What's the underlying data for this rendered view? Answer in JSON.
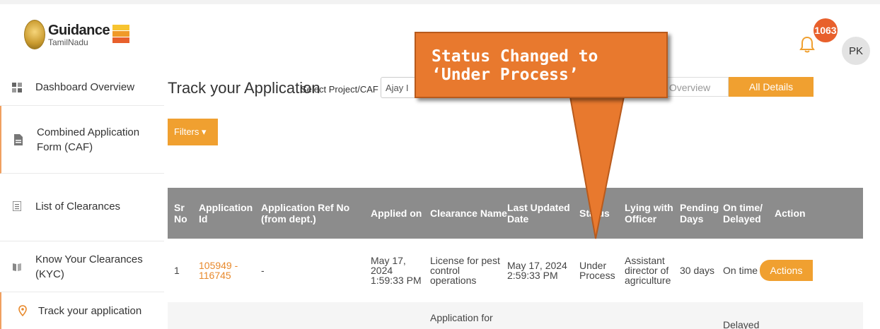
{
  "brand": {
    "name": "Guidance",
    "sub": "TamilNadu"
  },
  "notifications": {
    "count": "1063"
  },
  "user": {
    "initials": "PK"
  },
  "sidebar": {
    "items": [
      {
        "label": "Dashboard Overview",
        "icon": "dashboard-icon"
      },
      {
        "label": "Combined Application Form (CAF)",
        "icon": "document-icon"
      },
      {
        "label": "List of Clearances",
        "icon": "list-icon"
      },
      {
        "label": "Know Your Clearances (KYC)",
        "icon": "book-icon"
      },
      {
        "label": "Track your application",
        "icon": "location-pin-icon"
      }
    ]
  },
  "main": {
    "title": "Track your Application",
    "select_label": "Select Project/CAF",
    "select_value": "Ajay I",
    "tab_overview": "Overview",
    "tab_details": "All Details",
    "filters_label": "Filters ▾"
  },
  "table": {
    "headers": [
      "Sr No",
      "Application Id",
      "Application Ref No (from dept.)",
      "Applied on",
      "Clearance Name",
      "Last Updated Date",
      "Status",
      "Lying with Officer",
      "Pending Days",
      "On time/ Delayed",
      "Action"
    ],
    "row1": {
      "sr": "1",
      "app_id": "105949 - 116745",
      "ref_no": "-",
      "applied_on": "May 17, 2024 1:59:33 PM",
      "clearance": "License for pest control operations",
      "last_updated": "May 17, 2024 2:59:33 PM",
      "status": "Under Process",
      "officer": "Assistant director of agriculture",
      "pending": "30 days",
      "ontime": "On time",
      "action": "Actions"
    },
    "row2": {
      "clearance": "Application for",
      "ontime": "Delayed"
    }
  },
  "callout": {
    "text": "Status Changed to\n‘Under Process’"
  }
}
